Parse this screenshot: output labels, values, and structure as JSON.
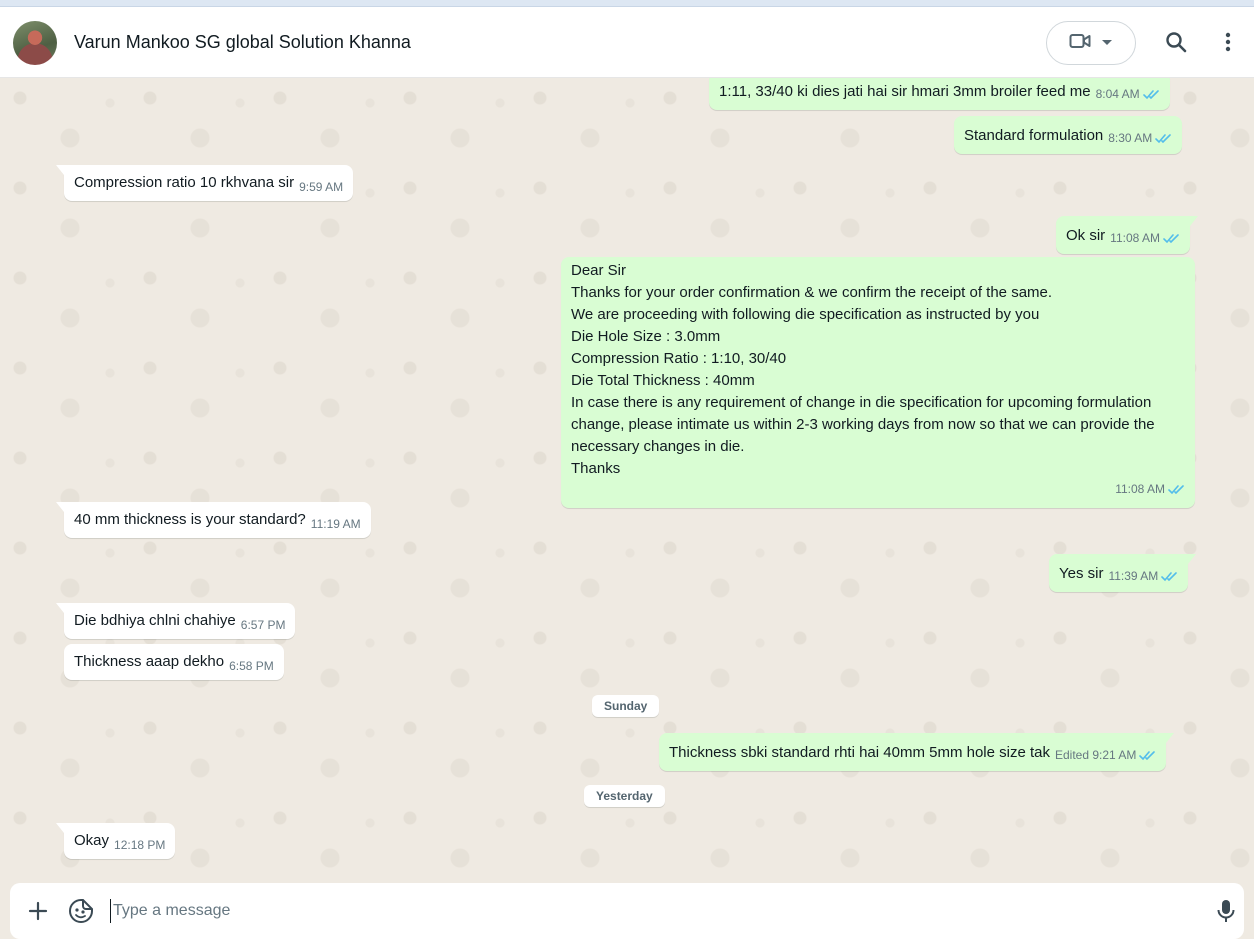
{
  "header": {
    "contact_name": "Varun Mankoo SG global Solution Khanna",
    "icons": [
      "video-call-icon",
      "chevron-down-icon",
      "search-icon",
      "menu-dots-icon"
    ]
  },
  "messages": [
    {
      "dir": "out",
      "lines": [
        "1:11, 33/40 ki dies jati hai sir hmari 3mm broiler feed me"
      ],
      "time": "8:04 AM",
      "ticks": "read"
    },
    {
      "dir": "out",
      "lines": [
        "Standard formulation"
      ],
      "time": "8:30 AM",
      "ticks": "read"
    },
    {
      "dir": "in",
      "lines": [
        "Compression ratio 10  rkhvana sir"
      ],
      "time": "9:59 AM"
    },
    {
      "dir": "out",
      "lines": [
        "Ok sir"
      ],
      "time": "11:08 AM",
      "ticks": "read"
    },
    {
      "dir": "out",
      "lines": [
        "Dear Sir",
        "Thanks for your order confirmation & we confirm the receipt of the same.",
        "We are proceeding with following die specification as instructed by you",
        "Die Hole Size : 3.0mm",
        "Compression Ratio : 1:10, 30/40",
        "Die Total Thickness : 40mm",
        "In case there is any requirement of change in die specification for upcoming formulation",
        "change, please intimate us within 2-3 working days from now so that we can provide the",
        "necessary changes in die.",
        "Thanks"
      ],
      "time": "11:08 AM",
      "ticks": "read"
    },
    {
      "dir": "in",
      "lines": [
        "40 mm thickness is your standard?"
      ],
      "time": "11:19 AM"
    },
    {
      "dir": "out",
      "lines": [
        "Yes sir"
      ],
      "time": "11:39 AM",
      "ticks": "read"
    },
    {
      "dir": "in",
      "lines": [
        "Die bdhiya chlni chahiye"
      ],
      "time": "6:57 PM"
    },
    {
      "dir": "in",
      "lines": [
        "Thickness aaap dekho"
      ],
      "time": "6:58 PM"
    },
    {
      "dir": "out",
      "lines": [
        "Thickness sbki standard rhti hai 40mm 5mm hole size tak"
      ],
      "time": "Edited 9:21 AM",
      "ticks": "read"
    },
    {
      "dir": "in",
      "lines": [
        "Okay"
      ],
      "time": "12:18 PM"
    }
  ],
  "day_separators": [
    "Sunday",
    "Yesterday"
  ],
  "composer": {
    "placeholder": "Type a message",
    "value": ""
  },
  "colors": {
    "incoming_bubble": "#ffffff",
    "outgoing_bubble": "#d9fdd3",
    "read_tick": "#53bdeb",
    "chat_background": "#efeae2"
  }
}
